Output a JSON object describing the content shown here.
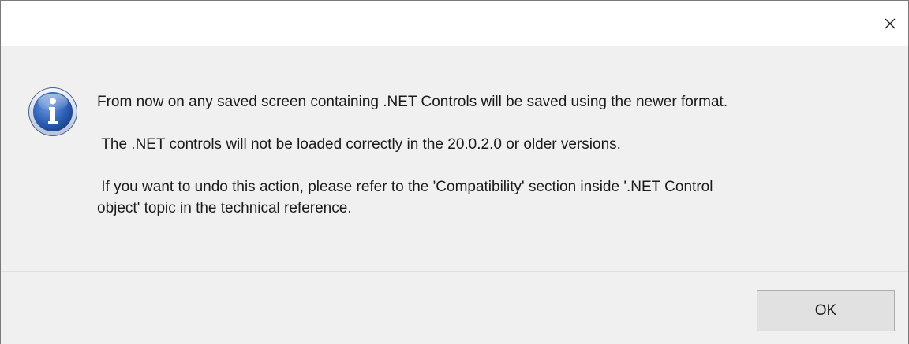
{
  "dialog": {
    "close_label": "×",
    "close_icon": "close-icon",
    "info_icon": "information-icon",
    "message": {
      "line1": "From now on any saved screen containing .NET Controls will be saved using the newer format.",
      "line2": " The .NET controls will not be loaded correctly in the 20.0.2.0 or older versions.",
      "line3a": " If you want to undo this action, please refer to the 'Compatibility' section inside '.NET Control",
      "line3b": "object' topic in the technical reference."
    },
    "ok_label": "OK"
  },
  "colors": {
    "body_bg": "#f0f0f0",
    "titlebar_bg": "#ffffff",
    "button_bg": "#e1e1e1",
    "button_border": "#adadad",
    "icon_blue": "#2a5db0"
  }
}
